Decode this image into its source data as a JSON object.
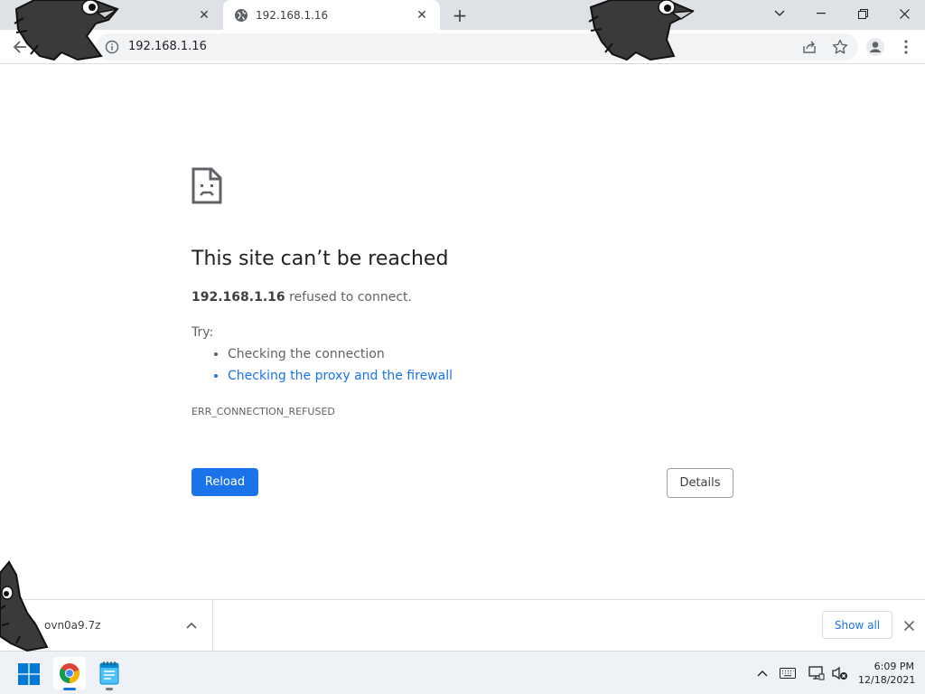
{
  "browser": {
    "tabs": [
      {
        "title": "",
        "active": false
      },
      {
        "title": "192.168.1.16",
        "active": true
      }
    ],
    "omnibox": {
      "url": "192.168.1.16"
    }
  },
  "error_page": {
    "title": "This site can’t be reached",
    "host": "192.168.1.16",
    "message": "refused to connect.",
    "try_label": "Try:",
    "suggestions": [
      {
        "text": "Checking the connection",
        "is_link": false
      },
      {
        "text": "Checking the proxy and the firewall",
        "is_link": true
      }
    ],
    "error_code": "ERR_CONNECTION_REFUSED",
    "reload_label": "Reload",
    "details_label": "Details"
  },
  "download_shelf": {
    "file_name": "ovn0a9.7z",
    "show_all_label": "Show all"
  },
  "taskbar": {
    "time": "6:09 PM",
    "date": "12/18/2021"
  },
  "colors": {
    "accent": "#1a73e8",
    "tab_strip": "#dee1e6",
    "omnibox_bg": "#f1f3f4"
  },
  "icons": [
    "globe-icon",
    "close-icon",
    "plus-icon",
    "back-arrow-icon",
    "info-icon",
    "share-icon",
    "star-icon",
    "profile-icon",
    "menu-dots-icon",
    "sad-page-icon",
    "file-icon",
    "chevron-up-icon",
    "windows-start-icon",
    "chrome-icon",
    "notepad-icon",
    "keyboard-icon",
    "network-icon",
    "volume-muted-icon"
  ]
}
